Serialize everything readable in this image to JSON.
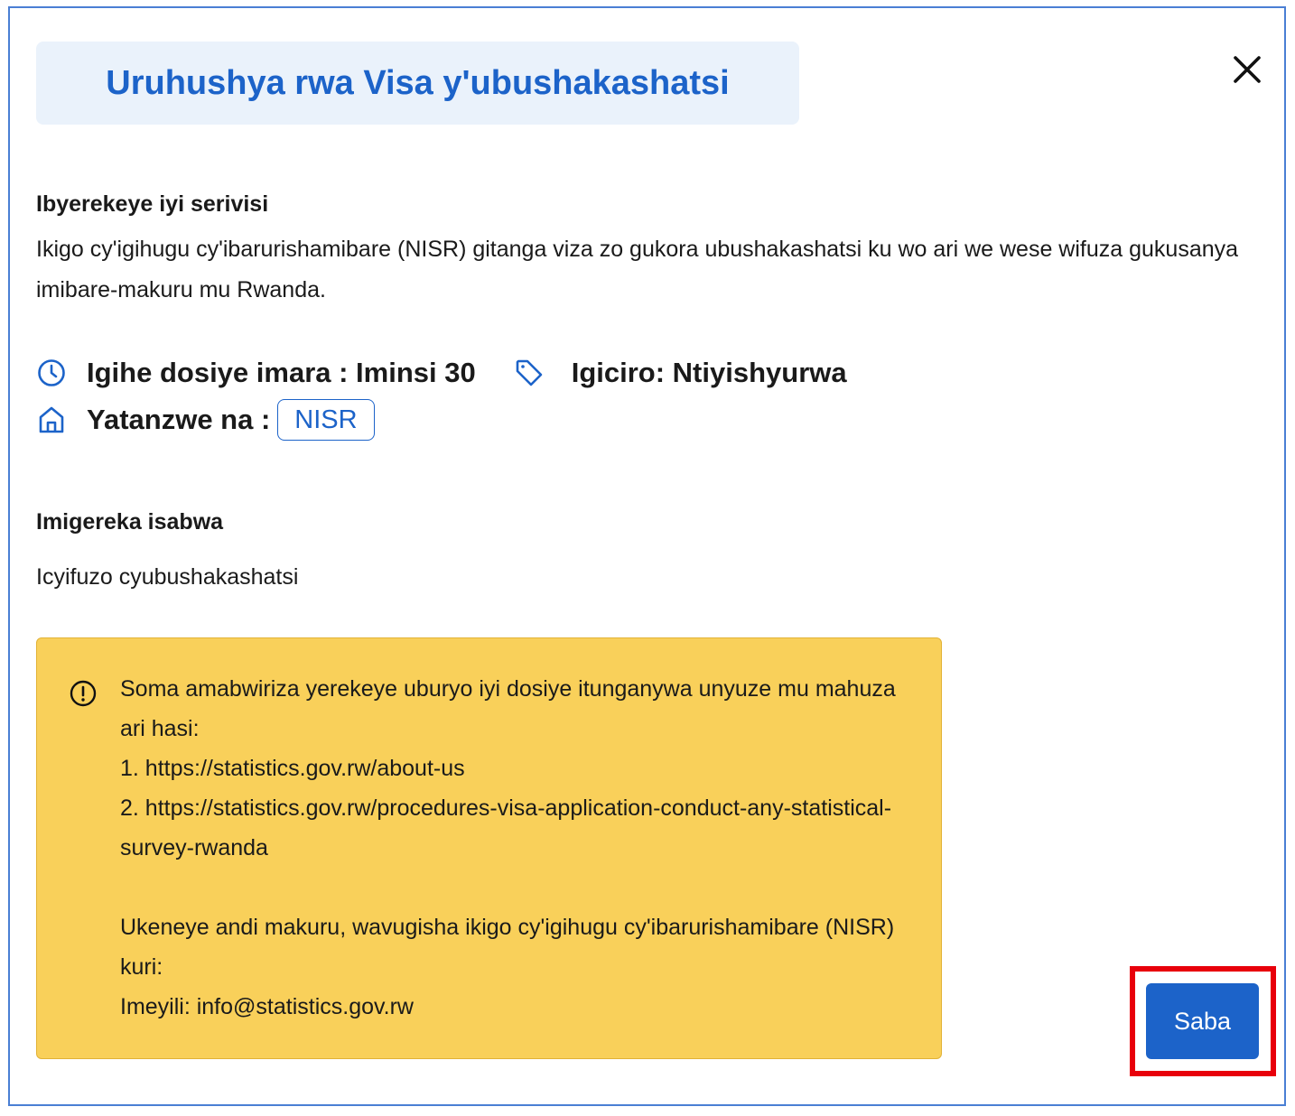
{
  "modal": {
    "title": "Uruhushya rwa Visa y'ubushakashatsi"
  },
  "about": {
    "heading": "Ibyerekeye iyi serivisi",
    "description": "Ikigo cy'igihugu cy'ibarurishamibare (NISR) gitanga viza zo gukora ubushakashatsi ku wo ari we wese wifuza gukusanya imibare-makuru mu Rwanda."
  },
  "meta": {
    "processing_time": "Igihe dosiye imara : Iminsi 30",
    "price": "Igiciro: Ntiyishyurwa",
    "provider_label": "Yatanzwe na :",
    "provider_badge": "NISR",
    "icons": [
      "clock-icon",
      "tag-icon",
      "home-icon"
    ]
  },
  "requirements": {
    "heading": "Imigereka isabwa",
    "items": [
      "Icyifuzo cyubushakashatsi"
    ]
  },
  "notice": {
    "icon": "info-icon",
    "lines": [
      "Soma amabwiriza yerekeye uburyo iyi dosiye itunganywa unyuze mu mahuza ari hasi:",
      "1. https://statistics.gov.rw/about-us",
      "2. https://statistics.gov.rw/procedures-visa-application-conduct-any-statistical-survey-rwanda",
      "",
      "Ukeneye andi makuru, wavugisha ikigo cy'igihugu cy'ibarurishamibare (NISR) kuri:",
      "Imeyili: info@statistics.gov.rw"
    ]
  },
  "actions": {
    "submit_label": "Saba"
  },
  "colors": {
    "accent": "#1c63c9",
    "title_bg": "#eaf2fb",
    "notice_bg": "#f9d05a",
    "highlight": "#e8000b"
  }
}
